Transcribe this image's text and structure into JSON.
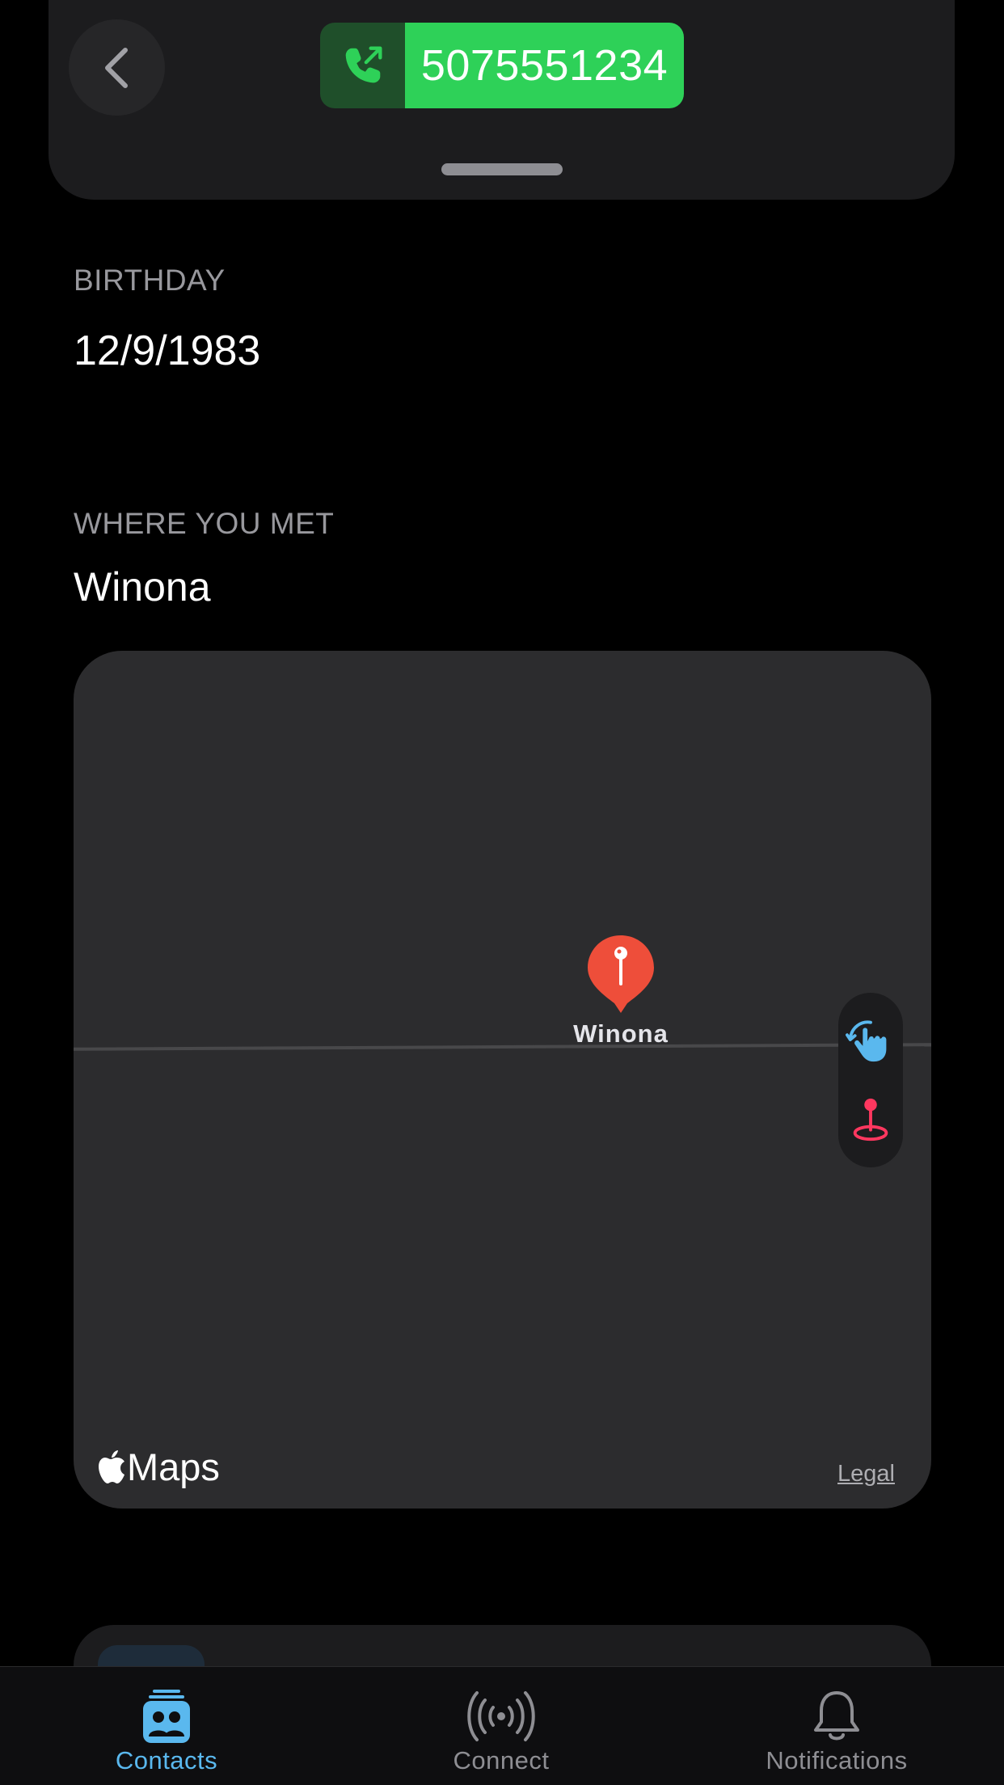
{
  "header": {
    "back_icon": "chevron-left-icon",
    "call_icon": "phone-outgoing-icon",
    "phone_number": "5075551234",
    "colors": {
      "call_green": "#2ed158",
      "call_icon_bg": "#1f4f2a"
    }
  },
  "birthday": {
    "label": "BIRTHDAY",
    "value": "12/9/1983"
  },
  "where_you_met": {
    "label": "WHERE YOU MET",
    "value": "Winona"
  },
  "map": {
    "pin_label": "Winona",
    "pin_color": "#ee4e3a",
    "brand": "Maps",
    "legal": "Legal",
    "controls": [
      "gesture-hand-icon",
      "location-pin-icon"
    ]
  },
  "tab_bar": {
    "tabs": [
      {
        "label": "Contacts",
        "icon": "contacts-icon",
        "active": true
      },
      {
        "label": "Connect",
        "icon": "broadcast-icon",
        "active": false
      },
      {
        "label": "Notifications",
        "icon": "bell-icon",
        "active": false
      }
    ],
    "active_color": "#5ab8ee"
  }
}
